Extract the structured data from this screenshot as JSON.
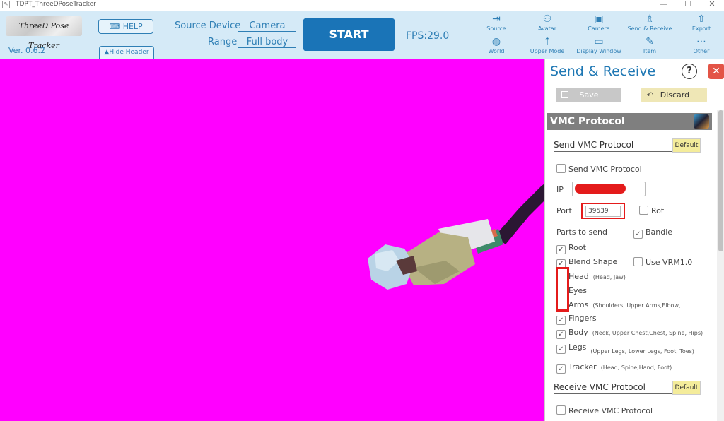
{
  "window": {
    "title": "TDPT_ThreeDPoseTracker",
    "controls": [
      "—",
      "☐",
      "✕"
    ]
  },
  "header": {
    "logo_text": "ThreeD Pose Tracker",
    "version": "Ver. 0.6.2",
    "help_label": "HELP",
    "hide_header_label": "▲Hide Header",
    "source_device_label": "Source Device",
    "source_device_value": "Camera",
    "range_label": "Range",
    "range_value": "Full body",
    "start_label": "START",
    "fps": "FPS:29.0"
  },
  "toolbar": {
    "items": [
      {
        "label": "Source",
        "icon": "source-icon"
      },
      {
        "label": "Avatar",
        "icon": "avatar-icon"
      },
      {
        "label": "Camera",
        "icon": "camera-icon"
      },
      {
        "label": "Send & Receive",
        "icon": "network-icon"
      },
      {
        "label": "Export",
        "icon": "export-icon"
      },
      {
        "label": "World",
        "icon": "globe-icon"
      },
      {
        "label": "Upper Mode",
        "icon": "upper-mode-icon"
      },
      {
        "label": "Display Window",
        "icon": "display-icon"
      },
      {
        "label": "Item",
        "icon": "pen-icon"
      },
      {
        "label": "Other",
        "icon": "more-icon"
      }
    ]
  },
  "panel": {
    "title": "Send & Receive",
    "help_glyph": "?",
    "close_glyph": "✕",
    "save_label": "Save",
    "discard_label": "Discard",
    "section_title": "VMC Protocol",
    "send_heading": "Send VMC Protocol",
    "default_label": "Default",
    "send_checkbox": "Send VMC Protocol",
    "ip_label": "IP",
    "port_label": "Port",
    "port_value": "39539",
    "rot_label": "Rot",
    "parts_label": "Parts to send",
    "bandle_label": "Bandle",
    "root_label": "Root",
    "blend_label": "Blend Shape",
    "vrm_label": "Use VRM1.0",
    "head_label": "Head",
    "head_note": "(Head, Jaw)",
    "eyes_label": "Eyes",
    "arms_label": "Arms",
    "arms_note": "(Shoulders, Upper Arms,Elbow,",
    "fingers_label": "Fingers",
    "body_label": "Body",
    "body_note": "(Neck, Upper Chest,Chest, Spine, Hips)",
    "legs_label": "Legs",
    "legs_note": "(Upper Legs, Lower Legs, Foot, Toes)",
    "tracker_label": "Tracker",
    "tracker_note": "(Head, Spine,Hand, Foot)",
    "receive_heading": "Receive VMC Protocol",
    "receive_checkbox": "Receive VMC Protocol"
  },
  "colors": {
    "header_bg": "#d5eaf7",
    "accent": "#2f7fb5",
    "viewport_bg": "#ff00ff",
    "highlight": "#e41b1b"
  }
}
